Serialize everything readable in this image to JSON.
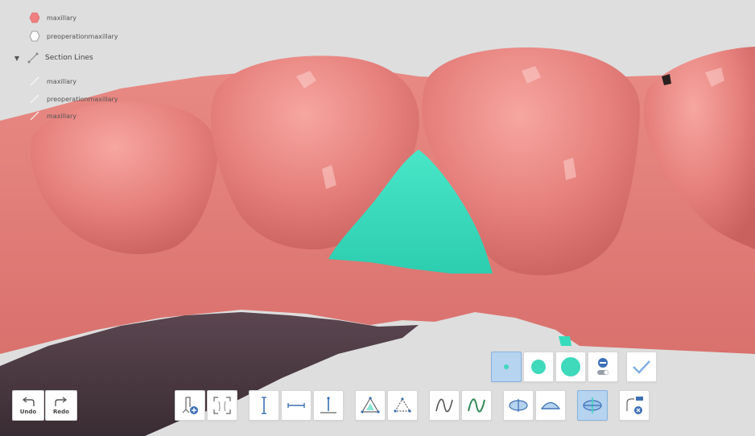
{
  "layers": {
    "items": [
      {
        "label": "maxillary",
        "icon": "hexagon-filled-icon",
        "color": "#f08080"
      },
      {
        "label": "preoperationmaxillary",
        "icon": "hexagon-outline-icon",
        "color": "#ffffff"
      }
    ],
    "section_lines": {
      "title": "Section Lines",
      "icon": "section-line-icon",
      "items": [
        {
          "label": "maxillary"
        },
        {
          "label": "preoperationmaxillary"
        },
        {
          "label": "maxillary"
        }
      ]
    }
  },
  "history": {
    "undo_label": "Undo",
    "redo_label": "Redo"
  },
  "toolbar": {
    "buttons": [
      {
        "name": "add-cut-plane-button",
        "active": false
      },
      {
        "name": "section-bracket-button",
        "active": false
      },
      {
        "name": "vertical-measure-button",
        "active": false
      },
      {
        "name": "horizontal-measure-button",
        "active": false
      },
      {
        "name": "height-measure-button",
        "active": false
      },
      {
        "name": "angle-measure-button",
        "active": false
      },
      {
        "name": "triangle-measure-button",
        "active": false
      },
      {
        "name": "curve-edit-button",
        "active": false
      },
      {
        "name": "curve-edit-green-button",
        "active": false
      },
      {
        "name": "plane-view-button",
        "active": false
      },
      {
        "name": "plane-side-view-button",
        "active": false
      },
      {
        "name": "plane-move-button",
        "active": true
      },
      {
        "name": "section-remove-button",
        "active": false
      }
    ]
  },
  "brush_panel": {
    "sizes": [
      "small",
      "medium",
      "large"
    ],
    "selected": "small",
    "accent_color": "#3fd9bb",
    "confirm_icon": "check-icon",
    "eraser_icon": "eraser-toggle-icon"
  },
  "colors": {
    "gum": "#e6807c",
    "tooth": "#e8847f",
    "selection": "#36dcbc",
    "background": "#dedede",
    "shadow_tissue": "#4c3a42"
  }
}
